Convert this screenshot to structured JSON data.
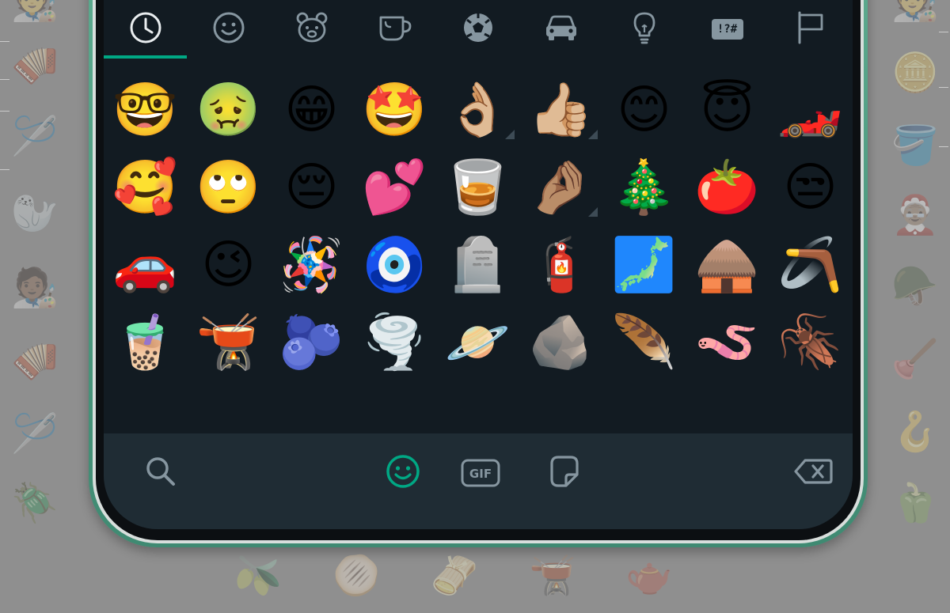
{
  "category_tabs": [
    {
      "name": "tab-recent",
      "icon": "clock-icon",
      "active": true
    },
    {
      "name": "tab-smileys",
      "icon": "smiley-icon"
    },
    {
      "name": "tab-animals",
      "icon": "bear-icon"
    },
    {
      "name": "tab-food",
      "icon": "cup-icon"
    },
    {
      "name": "tab-activities",
      "icon": "soccer-ball-icon"
    },
    {
      "name": "tab-travel",
      "icon": "car-icon"
    },
    {
      "name": "tab-objects",
      "icon": "lightbulb-icon"
    },
    {
      "name": "tab-symbols",
      "icon": "symbols-icon",
      "label": "!?#"
    },
    {
      "name": "tab-flags",
      "icon": "flag-icon"
    }
  ],
  "emoji_rows": [
    [
      "🤓",
      "🤢",
      "😁",
      "🤩",
      "👌🏼",
      "👍🏼",
      "😊",
      "😇",
      "🏎️"
    ],
    [
      "🥰",
      "🙄",
      "😔",
      "💕",
      "🥃",
      "🤌🏽",
      "🎄",
      "🍅",
      "😒"
    ],
    [
      "🚗",
      "😉",
      "🪅",
      "🧿",
      "🪦",
      "🧯",
      "🗾",
      "🛖",
      "🪃"
    ],
    [
      "🧋",
      "🫕",
      "🫐",
      "🌪️",
      "🪐",
      "🪨",
      "🪶",
      "🪱",
      "🪳"
    ]
  ],
  "variant_cells": [
    "0-4",
    "0-5",
    "1-5"
  ],
  "toolbar": {
    "search_icon": "search-icon",
    "emoji_icon": "smiley-icon",
    "gif_label": "GIF",
    "sticker_icon": "sticker-icon",
    "backspace_icon": "backspace-icon"
  },
  "background_emoji": {
    "left": [
      "🧑‍🎨",
      "🪗",
      "🪡",
      "🦭",
      "🧑🏾‍🎨",
      "🪗",
      "🪡",
      "🪲"
    ],
    "right": [
      "🧑‍🎨",
      "🪙",
      "🪣",
      "🤶🏽",
      "🪖",
      "🪠",
      "🪝",
      "🫑"
    ],
    "bottom": [
      "🫒",
      "🫓",
      "🫔",
      "🫕",
      "🫖"
    ]
  },
  "colors": {
    "accent": "#00a884",
    "icon": "#8696a0",
    "panel": "#121b22",
    "toolbar": "#1f2c34",
    "phone_frame": "#4f9c80"
  }
}
